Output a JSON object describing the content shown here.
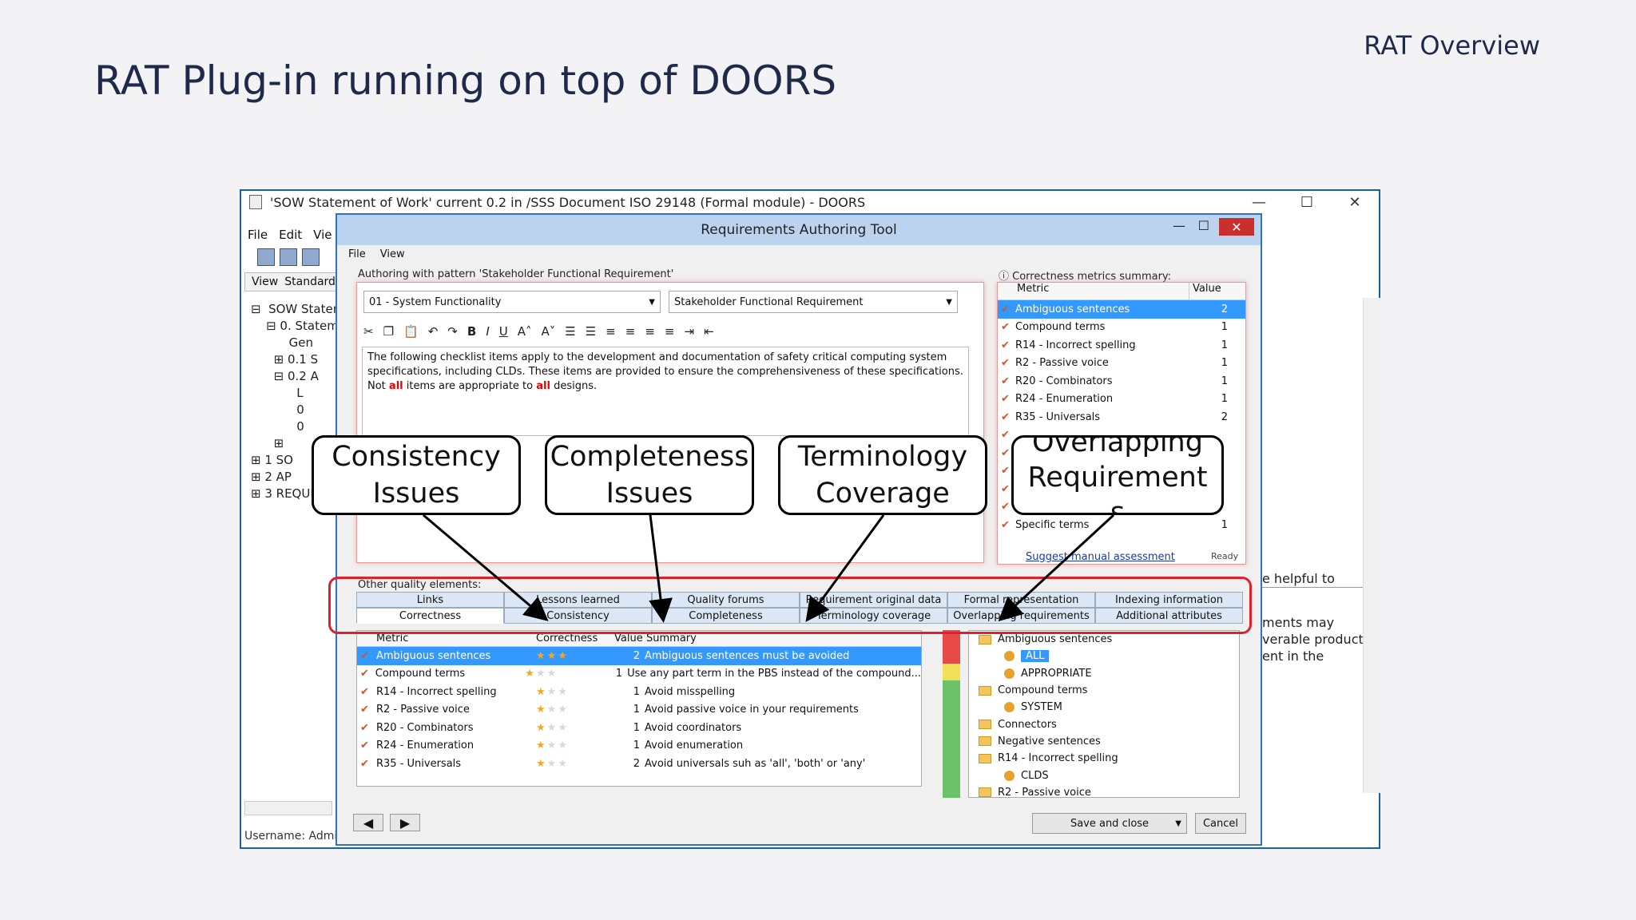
{
  "slide": {
    "title": "RAT Plug-in running on top of DOORS",
    "corner": "RAT Overview"
  },
  "doors": {
    "title": "'SOW Statement of Work' current 0.2 in /SSS Document ISO 29148 (Formal module) - DOORS",
    "menu": [
      "File",
      "Edit",
      "Vie"
    ],
    "view_label": "View",
    "view_value": "Standard",
    "tree": [
      "⊟  SOW Statem",
      "    ⊟ 0. Statem",
      "          Gen",
      "      ⊞ 0.1 S",
      "      ⊟ 0.2 A",
      "            L",
      "            0",
      "            0",
      "      ⊞",
      "⊞ 1 SO",
      "⊞ 2 AP",
      "⊞ 3 REQUI"
    ],
    "status": "Username: Admini",
    "right_text_1": "e helpful to",
    "right_text_2": "ments may\nverable product\nent in the",
    "win_controls": {
      "min": "—",
      "max": "☐",
      "close": "✕"
    }
  },
  "rat": {
    "title": "Requirements Authoring Tool",
    "close": "✕",
    "menu": [
      "File",
      "View"
    ],
    "pattern_label": "Authoring with pattern 'Stakeholder Functional Requirement'",
    "combo_left": "01 - System Functionality",
    "combo_right": "Stakeholder Functional Requirement",
    "editor_text_1": "The following checklist items apply to the development and documentation of safety critical computing system specifications, including CLDs. These items are provided to ensure the comprehensiveness of these specifications. Not ",
    "editor_all": "all",
    "editor_text_2": " items are appropriate to ",
    "editor_text_3": " designs.",
    "metrics_label": "Correctness metrics summary:",
    "metrics_headers": {
      "metric": "Metric",
      "value": "Value"
    },
    "metrics": [
      {
        "name": "Ambiguous sentences",
        "value": "2"
      },
      {
        "name": "Compound terms",
        "value": "1"
      },
      {
        "name": "R14 - Incorrect spelling",
        "value": "1"
      },
      {
        "name": "R2 - Passive voice",
        "value": "1"
      },
      {
        "name": "R20 - Combinators",
        "value": "1"
      },
      {
        "name": "R24 - Enumeration",
        "value": "1"
      },
      {
        "name": "R35 - Universals",
        "value": "2"
      },
      {
        "name": "",
        "value": ""
      },
      {
        "name": "",
        "value": ""
      },
      {
        "name": "",
        "value": ""
      },
      {
        "name": "",
        "value": ""
      },
      {
        "name": "",
        "value": ""
      },
      {
        "name": "Specific terms",
        "value": "1"
      }
    ],
    "suggest": "Suggest manual assessment",
    "ready": "Ready",
    "other_label": "Other quality elements:",
    "tabs_top": [
      "Links",
      "Lessons learned",
      "Quality forums",
      "Requirement original data",
      "Formal representation",
      "Indexing information"
    ],
    "tabs_bottom": [
      "Correctness",
      "Consistency",
      "Completeness",
      "Terminology coverage",
      "Overlapping requirements",
      "Additional attributes"
    ],
    "grid_headers": {
      "metric": "Metric",
      "correctness": "Correctness",
      "value": "Value",
      "summary": "Summary"
    },
    "grid": [
      {
        "metric": "Ambiguous sentences",
        "stars": 3,
        "value": "2",
        "summary": "Ambiguous sentences must be avoided"
      },
      {
        "metric": "Compound terms",
        "stars": 1,
        "value": "1",
        "summary": "Use any part term in the PBS instead of the compound..."
      },
      {
        "metric": "R14 - Incorrect spelling",
        "stars": 1,
        "value": "1",
        "summary": "Avoid misspelling"
      },
      {
        "metric": "R2 - Passive voice",
        "stars": 1,
        "value": "1",
        "summary": "Avoid passive voice in your requirements"
      },
      {
        "metric": "R20 - Combinators",
        "stars": 1,
        "value": "1",
        "summary": "Avoid  coordinators"
      },
      {
        "metric": "R24 - Enumeration",
        "stars": 1,
        "value": "1",
        "summary": "Avoid enumeration"
      },
      {
        "metric": "R35 - Universals",
        "stars": 1,
        "value": "2",
        "summary": "Avoid universals suh as 'all', 'both' or 'any'"
      }
    ],
    "tree": [
      {
        "label": "Ambiguous sentences",
        "kind": "folder",
        "indent": 0
      },
      {
        "label": "ALL",
        "kind": "dot",
        "indent": 1,
        "selected": true
      },
      {
        "label": "APPROPRIATE",
        "kind": "dot",
        "indent": 1
      },
      {
        "label": "Compound terms",
        "kind": "folder",
        "indent": 0
      },
      {
        "label": "SYSTEM",
        "kind": "dot",
        "indent": 1
      },
      {
        "label": "Connectors",
        "kind": "folder",
        "indent": 0
      },
      {
        "label": "Negative sentences",
        "kind": "folder",
        "indent": 0
      },
      {
        "label": "R14 - Incorrect spelling",
        "kind": "folder",
        "indent": 0
      },
      {
        "label": "CLDS",
        "kind": "dot",
        "indent": 1
      },
      {
        "label": "R2 - Passive voice",
        "kind": "folder",
        "indent": 0
      }
    ],
    "save_close": "Save and close",
    "cancel": "Cancel",
    "prev": "◀",
    "next": "▶"
  },
  "callouts": [
    {
      "text": "Consistency\nIssues"
    },
    {
      "text": "Completeness\nIssues"
    },
    {
      "text": "Terminology\nCoverage"
    },
    {
      "text": "Overlapping\nRequirement\ns"
    }
  ]
}
